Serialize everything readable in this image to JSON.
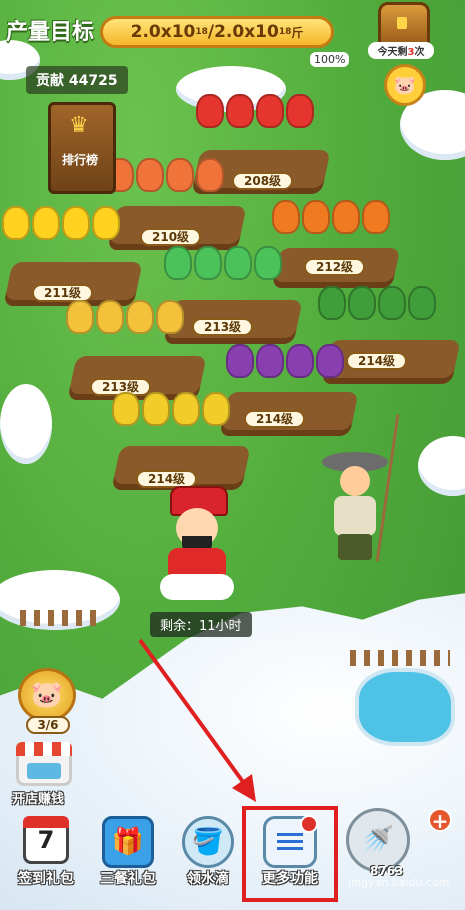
{
  "header": {
    "title": "产量目标",
    "target_value": "2.0x10",
    "target_exp1": "18",
    "target_sep": "/2.0x10",
    "target_exp2": "18",
    "target_unit": "斤",
    "progress": "100%",
    "contribution": "贡献 44725"
  },
  "chest": {
    "label_prefix": "今天剩",
    "label_count": "3",
    "label_suffix": "次"
  },
  "ranking_board": {
    "label": "排行榜"
  },
  "plots": [
    {
      "name": "tomato",
      "level": "208级"
    },
    {
      "name": "carrot",
      "level": "210级"
    },
    {
      "name": "sunflower",
      "level": "211级"
    },
    {
      "name": "pumpkin",
      "level": "212级"
    },
    {
      "name": "cucumber",
      "level": "213级"
    },
    {
      "name": "wheat",
      "level": "213级"
    },
    {
      "name": "watermelon",
      "level": "214级"
    },
    {
      "name": "eggplant",
      "level": "214级"
    },
    {
      "name": "corn",
      "level": "214级"
    }
  ],
  "remaining": "剩余：11小时",
  "side": {
    "piggy_count": "3/6",
    "shop_label": "开店赚钱"
  },
  "bottom_bar": {
    "checkin": {
      "label": "签到礼包",
      "icon_text": "7"
    },
    "meal_gift": {
      "label": "三餐礼包"
    },
    "collect_water": {
      "label": "领水滴"
    },
    "more": {
      "label": "更多功能"
    },
    "water_amount": "8763"
  },
  "watermark": "jingyan.baidu.com",
  "colors": {
    "highlight": "#e02020",
    "arrow": "#e02020"
  }
}
